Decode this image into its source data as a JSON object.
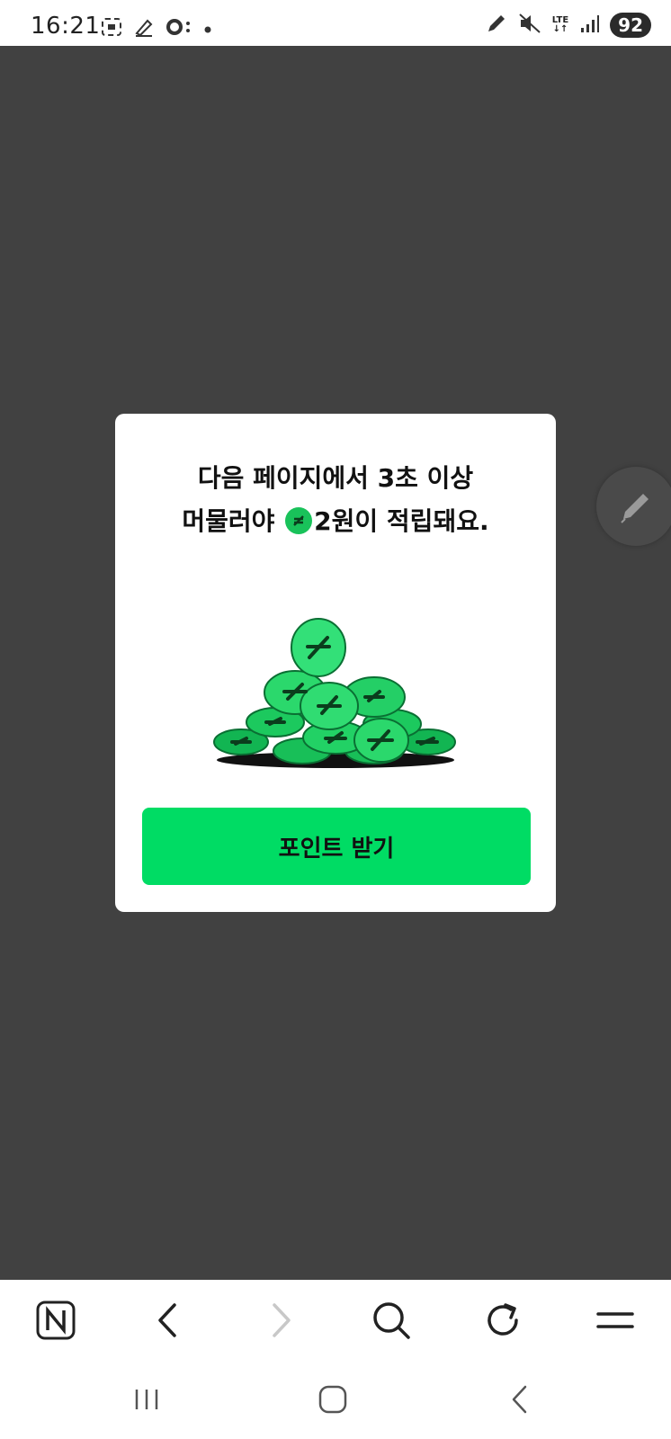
{
  "status_bar": {
    "time": "16:21",
    "battery": "92",
    "network": "LTE",
    "left_icons": [
      "screenshot-icon",
      "pencil-icon",
      "link-icon",
      "dot-icon"
    ],
    "right_icons": [
      "pen-icon",
      "mute-icon",
      "lte-icon",
      "signal-icon",
      "battery-icon"
    ]
  },
  "dialog": {
    "line1": "다음 페이지에서 3초 이상",
    "line2_prefix": "머물러야 ",
    "line2_suffix": "2원이 적립돼요.",
    "button_label": "포인트 받기"
  },
  "toolbar": {
    "buttons": [
      "naver-home-icon",
      "back-icon",
      "forward-icon",
      "search-icon",
      "refresh-icon",
      "menu-icon"
    ]
  },
  "colors": {
    "accent": "#00dc64",
    "coin": "#19c25a",
    "overlay": "#414141"
  }
}
